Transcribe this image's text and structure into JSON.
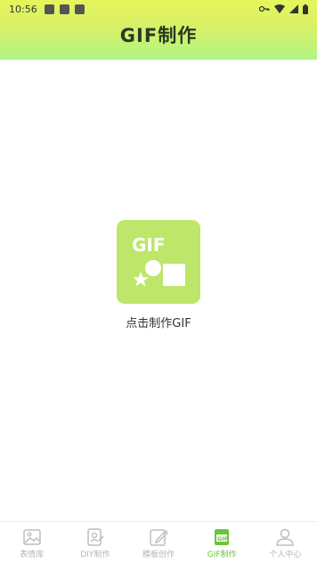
{
  "status": {
    "time": "10:56"
  },
  "header": {
    "title": "GIF制作"
  },
  "main": {
    "card_text": "GIF",
    "label": "点击制作GIF"
  },
  "tabs": [
    {
      "label": "表情库",
      "icon": "image-icon",
      "active": false
    },
    {
      "label": "DIY制作",
      "icon": "diy-edit-icon",
      "active": false
    },
    {
      "label": "模板创作",
      "icon": "template-edit-icon",
      "active": false
    },
    {
      "label": "GIF制作",
      "icon": "gif-icon",
      "active": true
    },
    {
      "label": "个人中心",
      "icon": "user-icon",
      "active": false
    }
  ],
  "colors": {
    "accent": "#6bc43b",
    "card": "#bde66a",
    "header_top": "#e6f55a",
    "header_bottom": "#aef585"
  }
}
